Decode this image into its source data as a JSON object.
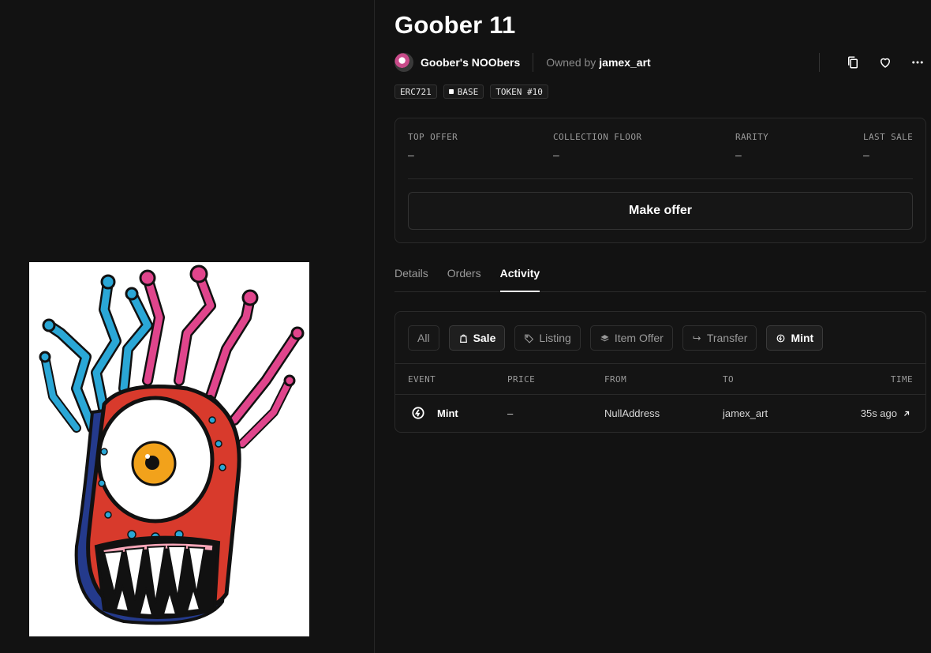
{
  "nft": {
    "title": "Goober 11",
    "collection_name": "Goober's NOObers",
    "owned_by_label": "Owned by",
    "owner": "jamex_art"
  },
  "badges": [
    "ERC721",
    "BASE",
    "TOKEN #10"
  ],
  "stats": {
    "top_offer": {
      "label": "TOP OFFER",
      "value": "–"
    },
    "collection_floor": {
      "label": "COLLECTION FLOOR",
      "value": "–"
    },
    "rarity": {
      "label": "RARITY",
      "value": "–"
    },
    "last_sale": {
      "label": "LAST SALE",
      "value": "–"
    }
  },
  "make_offer_label": "Make offer",
  "tabs": [
    {
      "label": "Details",
      "active": false
    },
    {
      "label": "Orders",
      "active": false
    },
    {
      "label": "Activity",
      "active": true
    }
  ],
  "filters": [
    {
      "label": "All",
      "icon": null,
      "selected": false
    },
    {
      "label": "Sale",
      "icon": "shopping-bag-icon",
      "selected": true
    },
    {
      "label": "Listing",
      "icon": "tag-icon",
      "selected": false
    },
    {
      "label": "Item Offer",
      "icon": "layers-icon",
      "selected": false
    },
    {
      "label": "Transfer",
      "icon": "arrow-right-icon",
      "selected": false
    },
    {
      "label": "Mint",
      "icon": "mint-icon",
      "selected": true
    }
  ],
  "activity_table": {
    "headers": [
      "EVENT",
      "PRICE",
      "FROM",
      "TO",
      "TIME"
    ],
    "rows": [
      {
        "event": "Mint",
        "event_icon": "mint-icon",
        "price": "–",
        "from": "NullAddress",
        "to": "jamex_art",
        "time": "35s ago"
      }
    ]
  },
  "colors": {
    "background": "#121212",
    "card": "#141414",
    "border": "#2a2a2a",
    "accent_pink": "#e0458c",
    "accent_blue": "#2aa7d6",
    "monster_red": "#d83a2c",
    "eye_orange": "#f2a21b"
  }
}
